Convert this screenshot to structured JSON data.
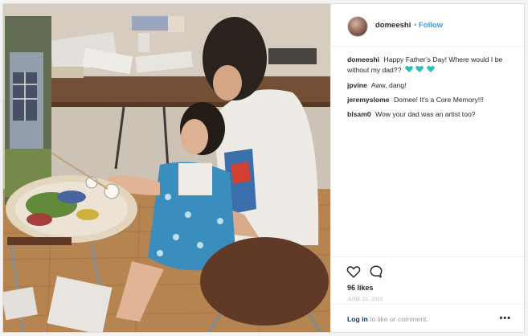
{
  "post": {
    "author": {
      "username": "domeeshi",
      "follow_label": "Follow",
      "separator": "•"
    },
    "caption": {
      "username": "domeeshi",
      "text": "Happy Father’s Day! Where would I be without my dad??",
      "emoji": [
        "teal-heart",
        "teal-heart",
        "teal-heart"
      ]
    },
    "comments": [
      {
        "username": "jpvine",
        "text": "Aww, dang!"
      },
      {
        "username": "jeremyslome",
        "text": "Domee! It's a Core Memory!!!"
      },
      {
        "username": "blsam0",
        "text": "Wow your dad was an artist too?"
      }
    ],
    "actions": {
      "like_icon": "heart-outline-icon",
      "comment_icon": "comment-bubble-icon"
    },
    "likes_label": "96 likes",
    "date": "JUNE 21, 2015",
    "footer": {
      "login_label": "Log in",
      "rest_text": " to like or comment.",
      "more_label": "•••"
    },
    "colors": {
      "link_blue": "#3897f0",
      "text_dark": "#262626",
      "muted": "#999999",
      "heart_teal": "#2bbfb7"
    }
  }
}
